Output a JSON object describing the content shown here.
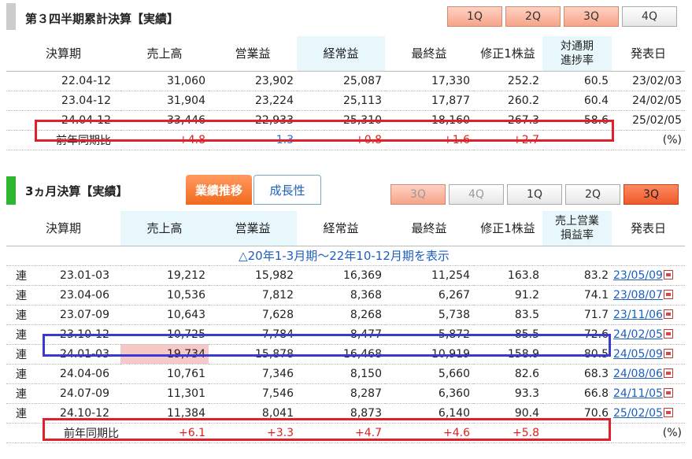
{
  "cumulative": {
    "title": "第３四半期累計決算【実績】",
    "tabs": [
      "1Q",
      "2Q",
      "3Q",
      "4Q"
    ],
    "headers": [
      "決算期",
      "売上高",
      "営業益",
      "経常益",
      "最終益",
      "修正1株益",
      "対通期\n進捗率",
      "発表日"
    ],
    "rows": [
      [
        "22.04-12",
        "31,060",
        "23,902",
        "25,087",
        "17,330",
        "252.2",
        "60.5",
        "23/02/03"
      ],
      [
        "23.04-12",
        "31,904",
        "23,224",
        "25,113",
        "17,877",
        "260.2",
        "60.4",
        "24/02/05"
      ],
      [
        "24.04-12",
        "33,446",
        "22,933",
        "25,310",
        "18,160",
        "267.3",
        "58.6",
        "25/02/05"
      ]
    ],
    "yoy": [
      "前年同期比",
      "+4.8",
      "−1.3",
      "+0.8",
      "+1.6",
      "+2.7",
      "",
      "(%)"
    ]
  },
  "quarterly": {
    "title": "3ヵ月決算【実績】",
    "subtabs": [
      "業績推移",
      "成長性"
    ],
    "tabs": [
      "3Q",
      "4Q",
      "1Q",
      "2Q",
      "3Q"
    ],
    "headers": [
      "決算期",
      "売上高",
      "営業益",
      "経常益",
      "最終益",
      "修正1株益",
      "売上営業\n損益率",
      "発表日"
    ],
    "notice": "△20年1-3月期〜22年10-12月期を表示",
    "rows": [
      [
        "連",
        "23.01-03",
        "19,212",
        "15,982",
        "16,369",
        "11,254",
        "163.8",
        "83.2",
        "23/05/09"
      ],
      [
        "連",
        "23.04-06",
        "10,536",
        "7,812",
        "8,368",
        "6,267",
        "91.2",
        "74.1",
        "23/08/07"
      ],
      [
        "連",
        "23.07-09",
        "10,643",
        "7,628",
        "8,268",
        "5,738",
        "83.5",
        "71.7",
        "23/11/06"
      ],
      [
        "連",
        "23.10-12",
        "10,725",
        "7,784",
        "8,477",
        "5,872",
        "85.5",
        "72.6",
        "24/02/05"
      ],
      [
        "連",
        "24.01-03",
        "19,734",
        "15,878",
        "16,468",
        "10,919",
        "158.9",
        "80.5",
        "24/05/09"
      ],
      [
        "連",
        "24.04-06",
        "10,761",
        "7,346",
        "8,150",
        "5,660",
        "82.6",
        "68.3",
        "24/08/06"
      ],
      [
        "連",
        "24.07-09",
        "11,301",
        "7,546",
        "8,287",
        "6,360",
        "93.3",
        "66.8",
        "24/11/05"
      ],
      [
        "連",
        "24.10-12",
        "11,384",
        "8,041",
        "8,873",
        "6,140",
        "90.4",
        "70.6",
        "25/02/05"
      ]
    ],
    "yoy": [
      "前年同期比",
      "+6.1",
      "+3.3",
      "+4.7",
      "+4.6",
      "+5.8",
      "",
      "(%)"
    ]
  },
  "colors": {
    "accent": "#ee5a2c",
    "highlight_red": "#e0202a",
    "highlight_blue": "#3a3ad0",
    "header_bg": "#e7f7fb"
  }
}
